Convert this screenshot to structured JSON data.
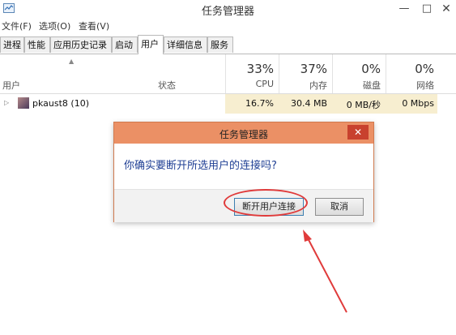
{
  "window": {
    "title": "任务管理器",
    "minimize": "—",
    "maximize": "□",
    "close": "✕"
  },
  "menu": [
    "文件(F)",
    "选项(O)",
    "查看(V)"
  ],
  "tabs": [
    {
      "label": "进程"
    },
    {
      "label": "性能"
    },
    {
      "label": "应用历史记录"
    },
    {
      "label": "启动"
    },
    {
      "label": "用户",
      "active": true
    },
    {
      "label": "详细信息"
    },
    {
      "label": "服务"
    }
  ],
  "columns": {
    "user": "用户",
    "status": "状态",
    "cpu": {
      "pct": "33%",
      "label": "CPU"
    },
    "memory": {
      "pct": "37%",
      "label": "内存"
    },
    "disk": {
      "pct": "0%",
      "label": "磁盘"
    },
    "network": {
      "pct": "0%",
      "label": "网络"
    }
  },
  "rows": [
    {
      "name": "pkaust8 (10)",
      "cpu": "16.7%",
      "memory": "30.4 MB",
      "disk": "0 MB/秒",
      "network": "0 Mbps"
    }
  ],
  "dialog": {
    "title": "任务管理器",
    "close": "✕",
    "message": "你确实要断开所选用户的连接吗?",
    "primary_button": "断开用户连接",
    "cancel_button": "取消"
  },
  "colors": {
    "dialog_title_bar": "#eb9065",
    "dialog_close": "#c8412e",
    "highlight_cells": "#f7eed0",
    "annotation_red": "#e03b3b",
    "message_text": "#1f3f94"
  },
  "icons": {
    "app": "task-manager-icon",
    "sort": "sort-up-icon",
    "expand": "chevron-right-icon",
    "annotation": "red-arrow-icon"
  }
}
